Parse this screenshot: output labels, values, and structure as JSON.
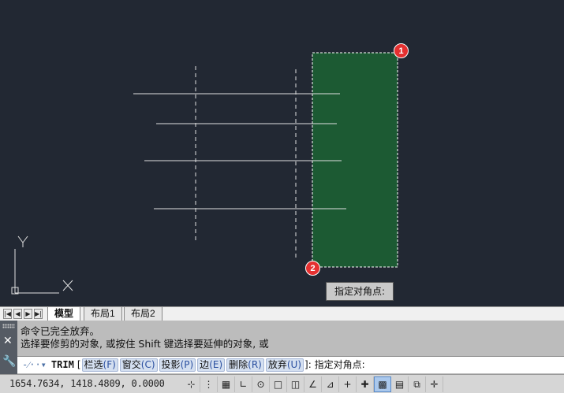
{
  "canvas": {
    "background": "#222833",
    "selection_fill": "#1c5a33",
    "line_color": "#e0e0e0",
    "markers": [
      "1",
      "2"
    ],
    "tooltip": "指定对角点:",
    "ucs_x_label": "X",
    "ucs_y_label": "Y"
  },
  "tabs": {
    "nav_icons": [
      "first-icon",
      "prev-icon",
      "next-icon",
      "last-icon"
    ],
    "items": [
      "模型",
      "布局1",
      "布局2"
    ],
    "active": "模型"
  },
  "command": {
    "history": [
      "命令已完全放弃。",
      "选择要修剪的对象, 或按住 Shift 键选择要延伸的对象, 或"
    ],
    "name": "TRIM",
    "open_bracket": "[",
    "options": [
      {
        "label": "栏选",
        "key": "(F)"
      },
      {
        "label": "窗交",
        "key": "(C)"
      },
      {
        "label": "投影",
        "key": "(P)"
      },
      {
        "label": "边",
        "key": "(E)"
      },
      {
        "label": "删除",
        "key": "(R)"
      },
      {
        "label": "放弃",
        "key": "(U)"
      }
    ],
    "close_bracket": "]:",
    "prompt_tail": "指定对角点:"
  },
  "status": {
    "coordinates": "1654.7634, 1418.4809, 0.0000",
    "tools": [
      {
        "name": "infer-constraints-icon",
        "glyph": "⊹",
        "on": false
      },
      {
        "name": "snap-icon",
        "glyph": "⋮",
        "on": false
      },
      {
        "name": "grid-icon",
        "glyph": "▦",
        "on": false
      },
      {
        "name": "ortho-icon",
        "glyph": "∟",
        "on": false
      },
      {
        "name": "polar-icon",
        "glyph": "⊙",
        "on": false
      },
      {
        "name": "osnap-icon",
        "glyph": "□",
        "on": false
      },
      {
        "name": "3d-osnap-icon",
        "glyph": "◫",
        "on": false
      },
      {
        "name": "object-track-icon",
        "glyph": "∠",
        "on": false
      },
      {
        "name": "ducs-icon",
        "glyph": "⊿",
        "on": false
      },
      {
        "name": "dynamic-input-icon",
        "glyph": "+",
        "on": false
      },
      {
        "name": "lineweight-icon",
        "glyph": "✚",
        "on": false
      },
      {
        "name": "transparency-icon",
        "glyph": "▩",
        "on": true
      },
      {
        "name": "quick-properties-icon",
        "glyph": "▤",
        "on": false
      },
      {
        "name": "selection-cycling-icon",
        "glyph": "⧉",
        "on": false
      },
      {
        "name": "annotation-monitor-icon",
        "glyph": "✛",
        "on": false
      }
    ]
  }
}
